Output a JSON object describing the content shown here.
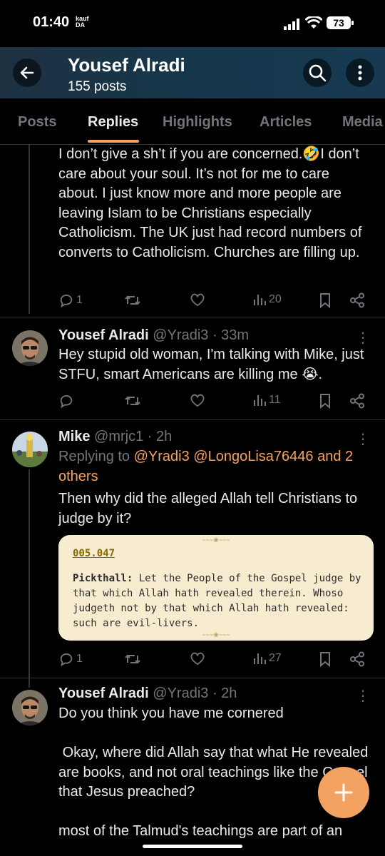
{
  "status": {
    "time": "01:40",
    "carrier": "kauf\nDA",
    "battery": "73"
  },
  "header": {
    "title": "Yousef Alradi",
    "subtitle": "155 posts"
  },
  "tabs": [
    "Posts",
    "Replies",
    "Highlights",
    "Articles",
    "Media"
  ],
  "posts": [
    {
      "text": "I don’t give a sh’t if you are concerned.🤣I don’t care about your soul. It’s not for me to care about. I just know more and more people are leaving Islam to be Christians especially Catholicism. The UK just had record numbers of converts to Catholicism. Churches are filling up.",
      "replies": "1",
      "retweets": "",
      "likes": "",
      "views": "20"
    },
    {
      "author": "Yousef Alradi",
      "handle": "@Yradi3",
      "time": "33m",
      "text": "Hey stupid old woman, I'm talking with Mike, just STFU, smart Americans are killing me 😭.",
      "replies": "",
      "retweets": "",
      "likes": "",
      "views": "11"
    },
    {
      "author": "Mike",
      "handle": "@mrjc1",
      "time": "2h",
      "replying_label": "Replying to",
      "replying_to": "@Yradi3 @LongoLisa76446 and 2 others",
      "text": "Then why did the alleged Allah tell Christians to judge by it?",
      "quote": {
        "ref": "005.047",
        "author": "Pickthall:",
        "body": "Let the People of the Gospel judge by that which Allah hath revealed therein. Whoso judgeth not by that which Allah hath revealed: such are evil-livers."
      },
      "replies": "1",
      "retweets": "",
      "likes": "",
      "views": "27"
    },
    {
      "author": "Yousef Alradi",
      "handle": "@Yradi3",
      "time": "2h",
      "text1": "Do you think you have me cornered",
      "text2": " Okay, where did Allah say that what He revealed are books, and not oral teachings like the Gospel that Jesus preached?",
      "text3": "most of the Talmud's teachings are part of an"
    }
  ],
  "icons": [
    "back-arrow-icon",
    "search-icon",
    "more-vertical-icon",
    "reply-icon",
    "retweet-icon",
    "like-icon",
    "views-icon",
    "bookmark-icon",
    "share-icon",
    "compose-plus-icon"
  ],
  "colors": {
    "accent": "#f4a261",
    "header_bg": "#15384d",
    "muted": "#71767b",
    "quote_bg": "#f7ecd0"
  }
}
